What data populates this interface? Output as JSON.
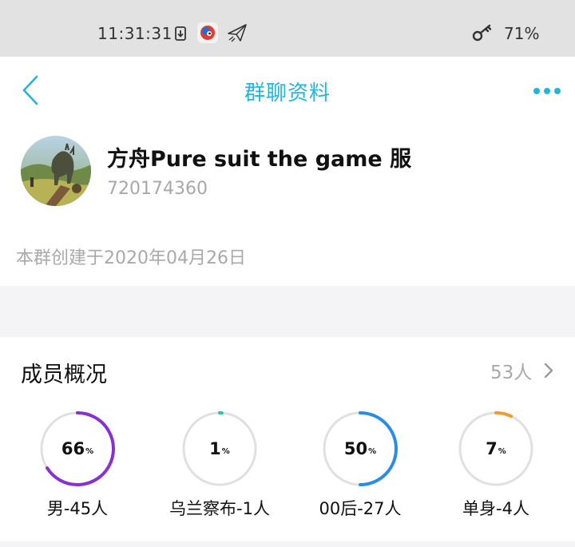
{
  "status_bar": {
    "time": "11:31:31",
    "battery": "71%",
    "icons": [
      "download-icon",
      "app-icon",
      "send-icon",
      "key-icon"
    ]
  },
  "nav": {
    "title": "群聊资料",
    "back_icon": "chevron-left-icon",
    "more_icon": "more-dots-icon"
  },
  "group": {
    "name": "方舟Pure suit the game 服",
    "id": "720174360",
    "created": "本群创建于2020年04月26日"
  },
  "members": {
    "title": "成员概况",
    "count": "53人",
    "stats": [
      {
        "value": 66,
        "num": "66",
        "unit": "%",
        "label": "男-45人",
        "color": "#8a2fd0"
      },
      {
        "value": 1,
        "num": "1",
        "unit": "%",
        "label": "乌兰察布-1人",
        "color": "#2cc4a0"
      },
      {
        "value": 50,
        "num": "50",
        "unit": "%",
        "label": "00后-27人",
        "color": "#2a8de3"
      },
      {
        "value": 7,
        "num": "7",
        "unit": "%",
        "label": "单身-4人",
        "color": "#f29a2e"
      }
    ]
  },
  "colors": {
    "accent": "#25b5db",
    "ring_track": "#e0e0e0",
    "status_bar_bg": "#e2e2e2"
  }
}
